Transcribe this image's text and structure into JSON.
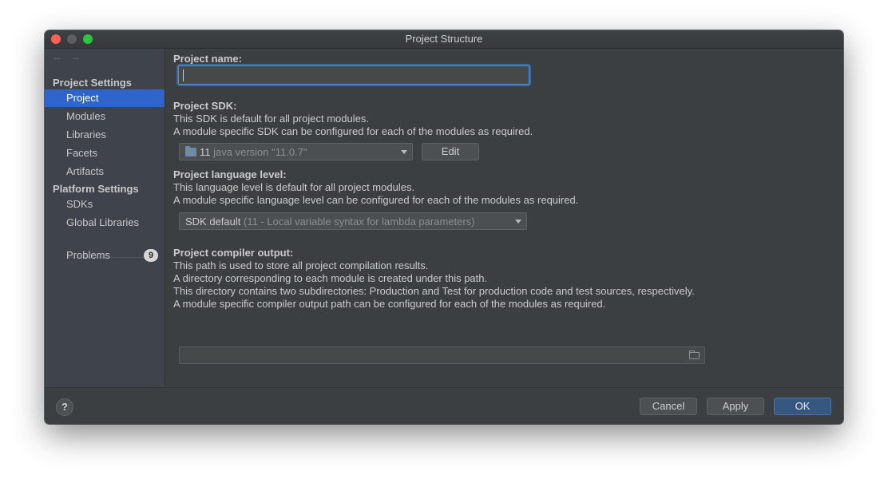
{
  "window": {
    "title": "Project Structure"
  },
  "sidebar": {
    "nav": {
      "back": "←",
      "forward": "→"
    },
    "project_settings_title": "Project Settings",
    "project_settings_items": [
      {
        "label": "Project",
        "selected": true
      },
      {
        "label": "Modules"
      },
      {
        "label": "Libraries"
      },
      {
        "label": "Facets"
      },
      {
        "label": "Artifacts"
      }
    ],
    "platform_settings_title": "Platform Settings",
    "platform_settings_items": [
      {
        "label": "SDKs"
      },
      {
        "label": "Global Libraries"
      }
    ],
    "problems": {
      "label": "Problems",
      "count": "9"
    }
  },
  "project_name": {
    "label": "Project name:",
    "value": ""
  },
  "project_sdk": {
    "label": "Project SDK:",
    "desc1": "This SDK is default for all project modules.",
    "desc2": "A module specific SDK can be configured for each of the modules as required.",
    "selected_version": "11",
    "selected_detail": "java version \"11.0.7\"",
    "edit_label": "Edit"
  },
  "language_level": {
    "label": "Project language level:",
    "desc1": "This language level is default for all project modules.",
    "desc2": "A module specific language level can be configured for each of the modules as required.",
    "selected": "SDK default",
    "selected_detail": "(11 - Local variable syntax for lambda parameters)"
  },
  "compiler_output": {
    "label": "Project compiler output:",
    "desc1": "This path is used to store all project compilation results.",
    "desc2": "A directory corresponding to each module is created under this path.",
    "desc3": "This directory contains two subdirectories: Production and Test for production code and test sources, respectively.",
    "desc4": "A module specific compiler output path can be configured for each of the modules as required.",
    "path": ""
  },
  "footer": {
    "help": "?",
    "cancel": "Cancel",
    "apply": "Apply",
    "ok": "OK"
  },
  "colors": {
    "selection": "#2f65ca",
    "ok_button": "#365880",
    "close": "#fe5f57",
    "maximize": "#28c840"
  }
}
